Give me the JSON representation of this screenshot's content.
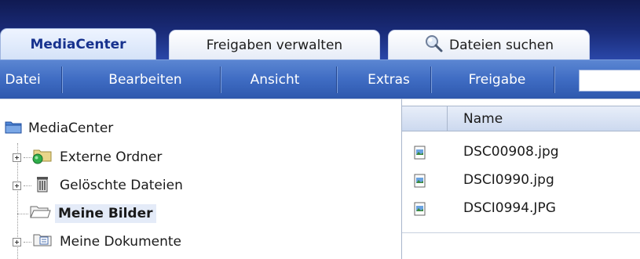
{
  "tabs": [
    {
      "label": "MediaCenter",
      "active": true
    },
    {
      "label": "Freigaben verwalten",
      "active": false
    },
    {
      "label": "Dateien suchen",
      "active": false,
      "icon": "search-icon"
    }
  ],
  "menu": {
    "items": [
      "Datei",
      "Bearbeiten",
      "Ansicht",
      "Extras",
      "Freigabe"
    ],
    "search_value": ""
  },
  "tree": {
    "root": {
      "label": "MediaCenter",
      "icon": "folder-icon"
    },
    "nodes": [
      {
        "label": "Externe Ordner",
        "icon": "external-folder-icon",
        "expandable": true
      },
      {
        "label": "Gelöschte Dateien",
        "icon": "trash-icon",
        "expandable": true
      },
      {
        "label": "Meine Bilder",
        "icon": "folder-open-icon",
        "expandable": false,
        "selected": true
      },
      {
        "label": "Meine Dokumente",
        "icon": "documents-folder-icon",
        "expandable": true
      }
    ]
  },
  "files": {
    "column_name": "Name",
    "rows": [
      {
        "name": "DSC00908.jpg",
        "icon": "image-file-icon"
      },
      {
        "name": "DSCI0990.jpg",
        "icon": "image-file-icon"
      },
      {
        "name": "DSCI0994.JPG",
        "icon": "image-file-icon"
      }
    ]
  },
  "colors": {
    "tabbar_dark": "#101a52",
    "menubar": "#3f6cc3",
    "active_tab_text": "#17328e"
  }
}
